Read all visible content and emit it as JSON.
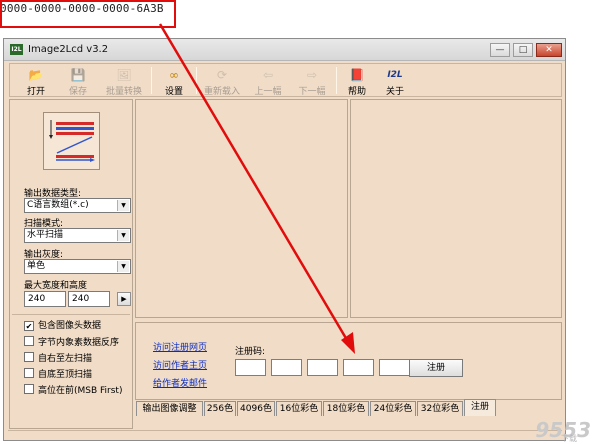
{
  "serial": "0000-0000-0000-0000-6A3B",
  "window": {
    "title": "Image2Lcd v3.2",
    "icon_text": "I2L"
  },
  "toolbar": [
    {
      "id": "open",
      "label": "打开",
      "icon": "📂",
      "enabled": true
    },
    {
      "id": "save",
      "label": "保存",
      "icon": "💾",
      "enabled": false
    },
    {
      "id": "batch",
      "label": "批量转换",
      "icon": "🖼",
      "enabled": false
    },
    {
      "id": "settings",
      "label": "设置",
      "icon": "👓",
      "enabled": true
    },
    {
      "id": "reload",
      "label": "重新载入",
      "icon": "🔄",
      "enabled": false
    },
    {
      "id": "prev",
      "label": "上一幅",
      "icon": "⬅",
      "enabled": false
    },
    {
      "id": "next",
      "label": "下一幅",
      "icon": "➡",
      "enabled": false
    },
    {
      "id": "help",
      "label": "帮助",
      "icon": "📕",
      "enabled": true
    },
    {
      "id": "about",
      "label": "关于",
      "icon": "I2L",
      "enabled": true
    }
  ],
  "left_panel": {
    "output_type_label": "输出数据类型:",
    "output_type_value": "C语言数组(*.c)",
    "scan_mode_label": "扫描模式:",
    "scan_mode_value": "水平扫描",
    "gray_label": "输出灰度:",
    "gray_value": "单色",
    "size_label": "最大宽度和高度",
    "width": "240",
    "height": "240",
    "checkboxes": [
      {
        "label": "包含图像头数据",
        "checked": true
      },
      {
        "label": "字节内象素数据反序",
        "checked": false
      },
      {
        "label": "自右至左扫描",
        "checked": false
      },
      {
        "label": "自底至顶扫描",
        "checked": false
      },
      {
        "label": "高位在前(MSB First)",
        "checked": false
      }
    ]
  },
  "register": {
    "links": [
      "访问注册网页",
      "访问作者主页",
      "给作者发邮件"
    ],
    "code_label": "注册码:",
    "button": "注册"
  },
  "tabs": [
    "输出图像调整",
    "256色",
    "4096色",
    "16位彩色",
    "18位彩色",
    "24位彩色",
    "32位彩色",
    "注册"
  ],
  "active_tab": "注册",
  "watermark": {
    "main": "9553",
    "sub": "下载"
  },
  "colors": {
    "window_bg": "#f0dcc7",
    "annotation_red": "#e10c0c",
    "link": "#0b2cc2"
  }
}
